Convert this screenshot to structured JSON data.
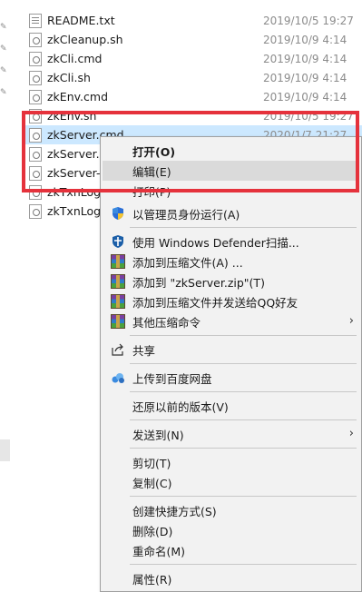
{
  "files": [
    {
      "name": "README.txt",
      "date": "2019/10/5 19:27",
      "icon": "text-file-icon"
    },
    {
      "name": "zkCleanup.sh",
      "date": "2019/10/9 4:14",
      "icon": "config-file-icon"
    },
    {
      "name": "zkCli.cmd",
      "date": "2019/10/9 4:14",
      "icon": "config-file-icon"
    },
    {
      "name": "zkCli.sh",
      "date": "2019/10/9 4:14",
      "icon": "config-file-icon"
    },
    {
      "name": "zkEnv.cmd",
      "date": "2019/10/9 4:14",
      "icon": "config-file-icon"
    },
    {
      "name": "zkEnv.sh",
      "date": "2019/10/5 19:27",
      "icon": "config-file-icon"
    },
    {
      "name": "zkServer.cmd",
      "date": "2020/1/7 21:27",
      "icon": "config-file-icon"
    },
    {
      "name": "zkServer.s",
      "date": "",
      "icon": "config-file-icon"
    },
    {
      "name": "zkServer-i",
      "date": "",
      "icon": "config-file-icon"
    },
    {
      "name": "zkTxnLogT",
      "date": "",
      "icon": "config-file-icon"
    },
    {
      "name": "zkTxnLogT",
      "date": "",
      "icon": "config-file-icon"
    }
  ],
  "menu": {
    "open": "打开(O)",
    "edit": "编辑(E)",
    "print": "打印(P)",
    "run_as_admin": "以管理员身份运行(A)",
    "defender_scan": "使用 Windows Defender扫描...",
    "add_to_archive": "添加到压缩文件(A) ...",
    "add_to_zip": "添加到 \"zkServer.zip\"(T)",
    "add_and_send_qq": "添加到压缩文件并发送给QQ好友",
    "other_compress": "其他压缩命令",
    "share": "共享",
    "upload_baidu": "上传到百度网盘",
    "restore_previous": "还原以前的版本(V)",
    "send_to": "发送到(N)",
    "cut": "剪切(T)",
    "copy": "复制(C)",
    "create_shortcut": "创建快捷方式(S)",
    "delete": "删除(D)",
    "rename": "重命名(M)",
    "properties": "属性(R)"
  },
  "colors": {
    "selection": "#cce8ff",
    "highlight_border": "#e5323c",
    "menu_bg": "#f2f2f2",
    "menu_hover": "#dadada"
  }
}
